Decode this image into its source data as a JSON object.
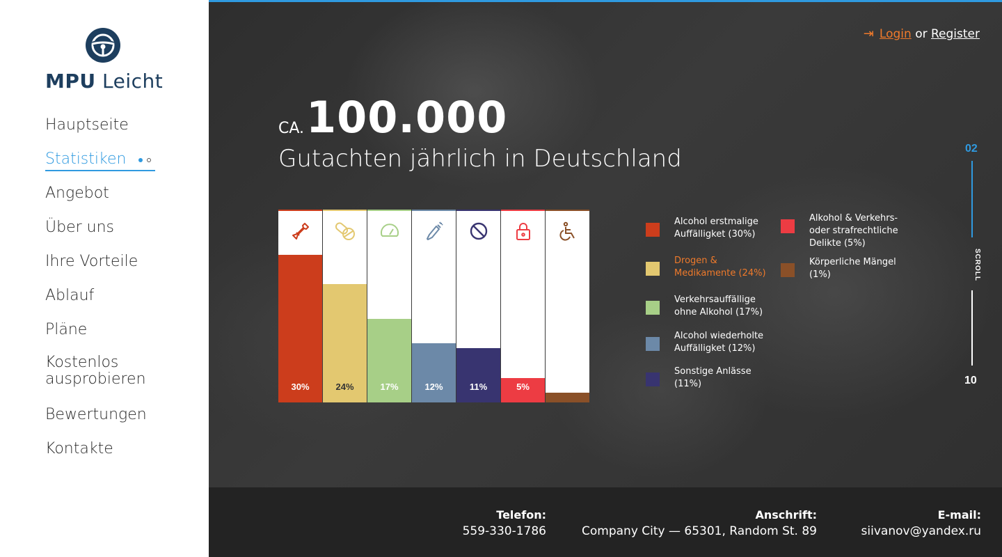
{
  "brand": {
    "name_bold": "MPU",
    "name_light": "Leicht"
  },
  "nav": {
    "items": [
      {
        "label": "Hauptseite"
      },
      {
        "label": "Statistiken",
        "active": true
      },
      {
        "label": "Angebot"
      },
      {
        "label": "Über uns"
      },
      {
        "label": "Ihre Vorteile"
      },
      {
        "label": "Ablauf"
      },
      {
        "label": "Pläne"
      },
      {
        "label": "Kostenlos ausprobieren"
      },
      {
        "label": "Bewertungen"
      },
      {
        "label": "Kontakte"
      }
    ]
  },
  "auth": {
    "login": "Login",
    "or": "or",
    "register": "Register"
  },
  "headline": {
    "prefix": "CA.",
    "number": "100.000",
    "subtitle": "Gutachten jährlich in Deutschland"
  },
  "colors": {
    "accent": "#2f9ae0",
    "orange": "#ef7a2b",
    "footer_bg": "#232323",
    "sidebar_text": "#2b2b2b"
  },
  "chart_data": {
    "type": "bar",
    "categories": [
      "Alcohol erstmalige Auffälligket",
      "Drogen & Medikamente",
      "Verkehrsauffällige ohne Alkohol",
      "Alcohol wiederholte Auffälligket",
      "Sonstige Anlässe",
      "Alkohol & Verkehrs- oder strafrechtliche Delikte",
      "Körperliche Mängel"
    ],
    "values": [
      30,
      24,
      17,
      12,
      11,
      5,
      1
    ],
    "value_labels": [
      "30%",
      "24%",
      "17%",
      "12%",
      "11%",
      "5%",
      ""
    ],
    "colors": [
      "#cc3d1c",
      "#e3c870",
      "#a7cf87",
      "#6c89a8",
      "#383470",
      "#ed3c43",
      "#8a5028"
    ],
    "icons": [
      "bottle-icon",
      "pills-icon",
      "speedometer-icon",
      "champagne-icon",
      "prohibited-icon",
      "lock-icon",
      "wheelchair-icon"
    ],
    "ylim": [
      0,
      100
    ]
  },
  "legend": [
    {
      "text1": "Alcohol erstmalige",
      "text2": "Auffälligket (30%)",
      "color": "#cc3d1c"
    },
    {
      "text1": "Drogen &",
      "text2": "Medikamente (24%)",
      "color": "#e3c870",
      "highlight": true
    },
    {
      "text1": "Verkehrsauffällige",
      "text2": "ohne Alkohol (17%)",
      "color": "#a7cf87"
    },
    {
      "text1": "Alcohol wiederholte",
      "text2": "Auffälligket (12%)",
      "color": "#6c89a8"
    },
    {
      "text1": "Sonstige Anlässe",
      "text2": "(11%)",
      "color": "#383470"
    },
    {
      "text1": "Alkohol & Verkehrs-",
      "text2": "oder strafrechtliche",
      "text3": "Delikte (5%)",
      "color": "#ed3c43"
    },
    {
      "text1": "Körperliche Mängel",
      "text2": "(1%)",
      "color": "#8a5028"
    }
  ],
  "scroll": {
    "current": "02",
    "label": "SCROLL",
    "total": "10"
  },
  "footer": {
    "phone_label": "Telefon:",
    "phone": "559-330-1786",
    "address_label": "Anschrift:",
    "address": "Company City — 65301, Random St. 89",
    "email_label": "E-mail:",
    "email": "siivanov@yandex.ru"
  }
}
